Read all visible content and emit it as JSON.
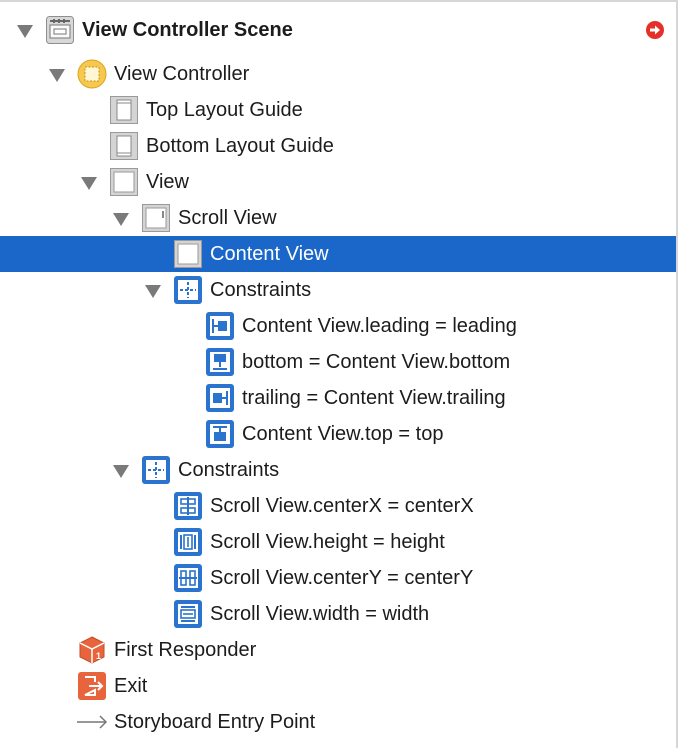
{
  "outline": {
    "scene": {
      "label": "View Controller Scene",
      "icon": "scene-icon",
      "has_alert": true,
      "alert_icon": "red-arrow-circle-icon"
    },
    "view_controller": {
      "label": "View Controller",
      "icon": "view-controller-icon"
    },
    "top_layout_guide": {
      "label": "Top Layout Guide",
      "icon": "layout-guide-icon"
    },
    "bottom_layout_guide": {
      "label": "Bottom Layout Guide",
      "icon": "layout-guide-icon"
    },
    "view": {
      "label": "View",
      "icon": "view-icon"
    },
    "scroll_view": {
      "label": "Scroll View",
      "icon": "scroll-view-icon"
    },
    "content_view": {
      "label": "Content View",
      "icon": "view-icon",
      "selected": true
    },
    "content_constraints": {
      "label": "Constraints",
      "icon": "constraints-icon",
      "items": [
        {
          "label": "Content View.leading = leading",
          "icon": "leading-constraint-icon"
        },
        {
          "label": "bottom = Content View.bottom",
          "icon": "bottom-constraint-icon"
        },
        {
          "label": "trailing = Content View.trailing",
          "icon": "trailing-constraint-icon"
        },
        {
          "label": "Content View.top = top",
          "icon": "top-constraint-icon"
        }
      ]
    },
    "view_constraints": {
      "label": "Constraints",
      "icon": "constraints-icon",
      "items": [
        {
          "label": "Scroll View.centerX = centerX",
          "icon": "center-x-constraint-icon"
        },
        {
          "label": "Scroll View.height = height",
          "icon": "height-constraint-icon"
        },
        {
          "label": "Scroll View.centerY = centerY",
          "icon": "center-y-constraint-icon"
        },
        {
          "label": "Scroll View.width = width",
          "icon": "width-constraint-icon"
        }
      ]
    },
    "first_responder": {
      "label": "First Responder",
      "icon": "first-responder-icon"
    },
    "exit": {
      "label": "Exit",
      "icon": "exit-icon"
    },
    "entry_point": {
      "label": "Storyboard Entry Point",
      "icon": "arrow-right-icon"
    }
  },
  "colors": {
    "selection": "#1a67c9",
    "constraint_icon": "#2a74cf",
    "orange_icon": "#e8643c",
    "alert": "#e5302a"
  }
}
